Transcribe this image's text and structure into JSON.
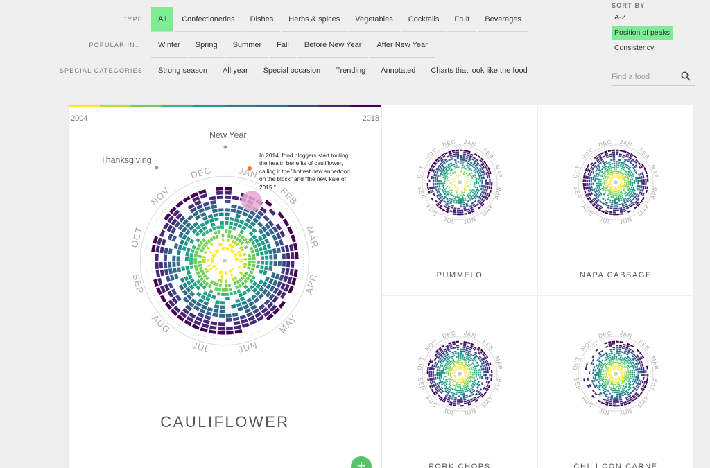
{
  "filters": [
    {
      "label": "TYPE",
      "options": [
        "All",
        "Confectioneries",
        "Dishes",
        "Herbs & spices",
        "Vegetables",
        "Cocktails",
        "Fruit",
        "Beverages"
      ],
      "active": 0
    },
    {
      "label": "POPULAR IN...",
      "options": [
        "Winter",
        "Spring",
        "Summer",
        "Fall",
        "Before New Year",
        "After New Year"
      ],
      "active": -1
    },
    {
      "label": "SPECIAL CATEGORIES",
      "options": [
        "Strong season",
        "All year",
        "Special occasion",
        "Trending",
        "Annotated",
        "Charts that look like the food"
      ],
      "active": -1
    }
  ],
  "sort": {
    "label": "SORT BY",
    "options": [
      "A-Z",
      "Position of peaks",
      "Consistency"
    ],
    "active": 1
  },
  "search": {
    "placeholder": "Find a food",
    "icon": "search-icon"
  },
  "months": [
    "JAN",
    "FEB",
    "MAR",
    "APR",
    "MAY",
    "JUN",
    "JUL",
    "AUG",
    "SEP",
    "OCT",
    "NOV",
    "DEC"
  ],
  "featured": {
    "name": "CAULIFLOWER",
    "year_start": "2004",
    "year_end": "2018",
    "events": [
      "New Year",
      "Thanksgiving"
    ],
    "note": "In 2014, food bloggers start touting the health benefits of cauliflower, calling it the \"hottest new superfood on the block\" and \"the new kale of 2015.\"",
    "expand_label": "+"
  },
  "cards": [
    {
      "name": "PUMMELO"
    },
    {
      "name": "NAPA CABBAGE"
    },
    {
      "name": "PORK CHOPS"
    },
    {
      "name": "CHILI CON CARNE"
    }
  ],
  "colors": {
    "accent": "#7ded94",
    "add_button": "#56c36a",
    "viridis": [
      "#fde725",
      "#b5de2b",
      "#6ece58",
      "#35b779",
      "#1f9e89",
      "#26828e",
      "#31688e",
      "#3e4989",
      "#482878",
      "#440154"
    ]
  }
}
